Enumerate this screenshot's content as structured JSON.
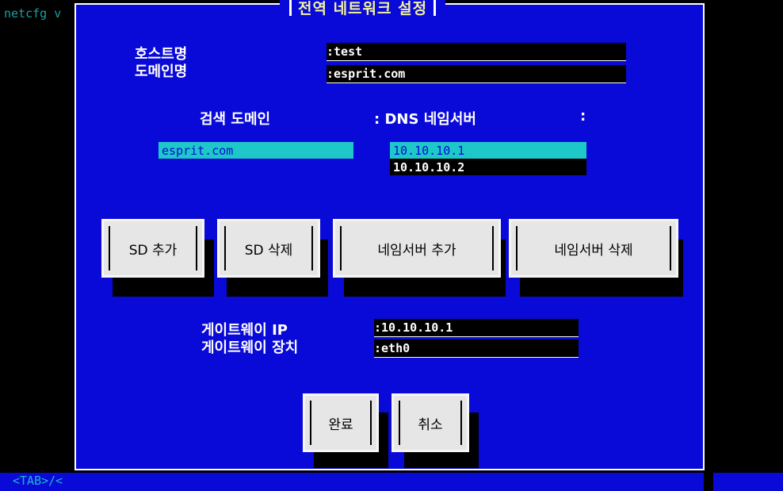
{
  "background": {
    "app_text": "netcfg v",
    "hint": "<TAB>/<"
  },
  "dialog": {
    "title": "전역 네트워크 설정"
  },
  "host": {
    "hostname_label": "호스트명",
    "domain_label": "도메인명",
    "hostname_value": ":test",
    "domain_value": ":esprit.com"
  },
  "lists": {
    "search_label": "검색 도메인",
    "colon": ":",
    "dns_label": ": DNS 네임서버",
    "search_domains": [
      "esprit.com"
    ],
    "nameservers": [
      "10.10.10.1",
      "10.10.10.2"
    ]
  },
  "buttons": {
    "sd_add": "SD 추가",
    "sd_delete": "SD 삭제",
    "ns_add": "네임서버 추가",
    "ns_delete": "네임서버 삭제",
    "ok": "완료",
    "cancel": "취소"
  },
  "gateway": {
    "ip_label": "게이트웨이 IP",
    "device_label": "게이트웨이 장치",
    "ip_value": ":10.10.10.1",
    "device_value": ":eth0"
  },
  "colors": {
    "dialog_bg": "#0a0ad8",
    "selection": "#1ec8c8",
    "button_face": "#e6e6e6",
    "title_text": "#f2f2a0"
  }
}
